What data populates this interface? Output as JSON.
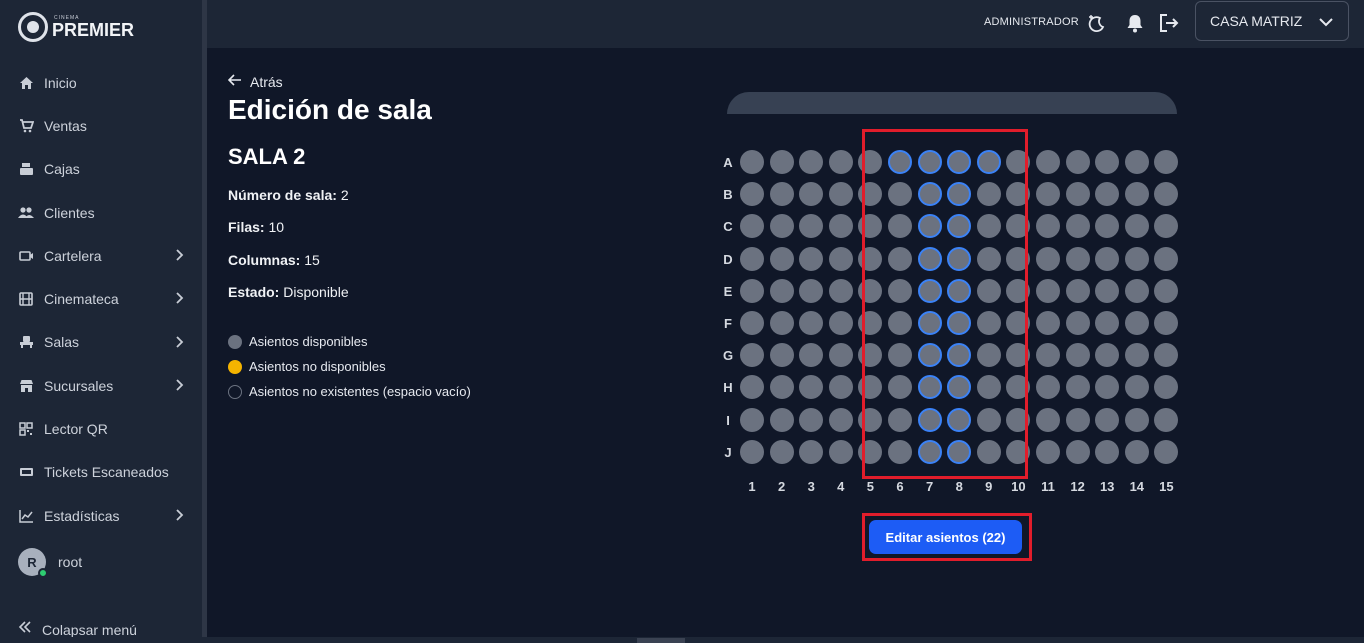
{
  "brand": {
    "small": "CINEMA",
    "big": "PREMIER"
  },
  "sidebar": {
    "items": [
      {
        "label": "Inicio",
        "icon": "home-icon",
        "has_submenu": false
      },
      {
        "label": "Ventas",
        "icon": "cart-icon",
        "has_submenu": false
      },
      {
        "label": "Cajas",
        "icon": "cash-register-icon",
        "has_submenu": false
      },
      {
        "label": "Clientes",
        "icon": "users-icon",
        "has_submenu": false
      },
      {
        "label": "Cartelera",
        "icon": "ticket-icon",
        "has_submenu": true
      },
      {
        "label": "Cinemateca",
        "icon": "film-icon",
        "has_submenu": true
      },
      {
        "label": "Salas",
        "icon": "seat-icon",
        "has_submenu": true
      },
      {
        "label": "Sucursales",
        "icon": "store-icon",
        "has_submenu": true
      },
      {
        "label": "Lector QR",
        "icon": "qr-icon",
        "has_submenu": false
      },
      {
        "label": "Tickets Escaneados",
        "icon": "tickets-scanned-icon",
        "has_submenu": false
      },
      {
        "label": "Estadísticas",
        "icon": "chart-line-icon",
        "has_submenu": true
      }
    ],
    "user": {
      "initial": "R",
      "name": "root",
      "status": "online"
    },
    "collapse_label": "Colapsar menú"
  },
  "topbar": {
    "role": "ADMINISTRADOR",
    "branch": "CASA MATRIZ"
  },
  "main": {
    "back_label": "Atrás",
    "title": "Edición de sala",
    "room_name": "SALA 2",
    "info": [
      {
        "label": "Número de sala:",
        "value": "2"
      },
      {
        "label": "Filas:",
        "value": "10"
      },
      {
        "label": "Columnas:",
        "value": "15"
      },
      {
        "label": "Estado:",
        "value": "Disponible"
      }
    ],
    "legend": [
      {
        "label": "Asientos disponibles",
        "color": "#6b7280",
        "outline": false
      },
      {
        "label": "Asientos no disponibles",
        "color": "#f5b400",
        "outline": false
      },
      {
        "label": "Asientos no existentes (espacio vacío)",
        "color": "#101728",
        "outline": true
      }
    ],
    "seat_map": {
      "rows": [
        "A",
        "B",
        "C",
        "D",
        "E",
        "F",
        "G",
        "H",
        "I",
        "J"
      ],
      "columns": [
        "1",
        "2",
        "3",
        "4",
        "5",
        "6",
        "7",
        "8",
        "9",
        "10",
        "11",
        "12",
        "13",
        "14",
        "15"
      ],
      "selected": {
        "A": [
          6,
          7,
          8,
          9
        ],
        "B": [
          7,
          8
        ],
        "C": [
          7,
          8
        ],
        "D": [
          7,
          8
        ],
        "E": [
          7,
          8
        ],
        "F": [
          7,
          8
        ],
        "G": [
          7,
          8
        ],
        "H": [
          7,
          8
        ],
        "I": [
          7,
          8
        ],
        "J": [
          7,
          8
        ]
      },
      "seat_color": "#6b7280",
      "selected_outline": "#3b82f6"
    },
    "edit_button_label": "Editar asientos (22)"
  },
  "colors": {
    "accent": "#1d5cf5",
    "highlight": "#e11d2b",
    "sidebar": "#1d2636",
    "background": "#101728"
  }
}
